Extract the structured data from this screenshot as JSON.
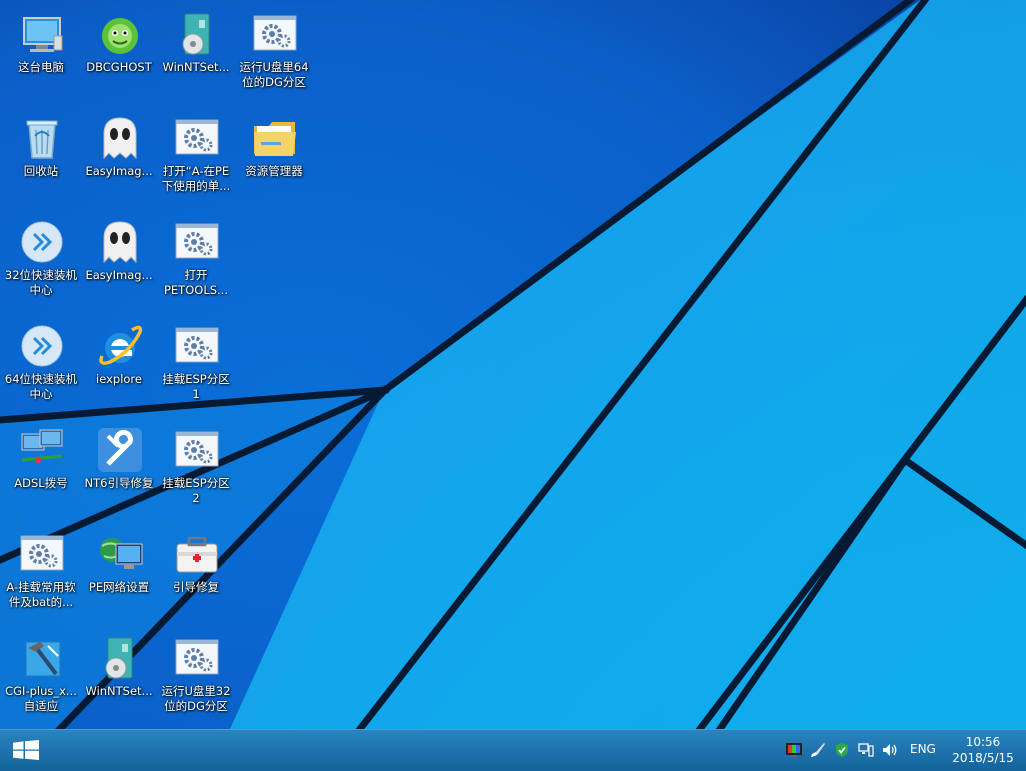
{
  "desktop": {
    "icons": [
      {
        "label": "这台电脑",
        "icon": "computer-icon"
      },
      {
        "label": "DBCGHOST",
        "icon": "ghost-cabbage-icon"
      },
      {
        "label": "WinNTSet...",
        "icon": "setup-disc-icon"
      },
      {
        "label": "运行U盘里64\n位的DG分区",
        "icon": "settings-script-icon"
      },
      {
        "label": "回收站",
        "icon": "recycle-bin-icon"
      },
      {
        "label": "EasyImag...",
        "icon": "ghost-icon"
      },
      {
        "label": "打开“A-在PE\n下使用的单...",
        "icon": "settings-script-icon"
      },
      {
        "label": "资源管理器",
        "icon": "folder-icon"
      },
      {
        "label": "32位快速装机\n中心",
        "icon": "fast-install-icon"
      },
      {
        "label": "EasyImag...",
        "icon": "ghost-icon"
      },
      {
        "label": "打开\nPETOOLS...",
        "icon": "settings-script-icon"
      },
      {
        "label": "64位快速装机\n中心",
        "icon": "fast-install-icon"
      },
      {
        "label": "iexplore",
        "icon": "internet-explorer-icon"
      },
      {
        "label": "挂载ESP分区\n1",
        "icon": "settings-script-icon"
      },
      {
        "label": "ADSL拨号",
        "icon": "network-dial-icon"
      },
      {
        "label": "NT6引导修复",
        "icon": "wrench-icon"
      },
      {
        "label": "挂载ESP分区\n2",
        "icon": "settings-script-icon"
      },
      {
        "label": "A-挂载常用软\n件及bat的...",
        "icon": "settings-script-icon"
      },
      {
        "label": "PE网络设置",
        "icon": "network-globe-icon"
      },
      {
        "label": "引导修复",
        "icon": "first-aid-kit-icon"
      },
      {
        "label": "CGI-plus_x...\n自适应",
        "icon": "hammer-tool-icon"
      },
      {
        "label": "WinNTSet...",
        "icon": "setup-disc-icon"
      },
      {
        "label": "运行U盘里32\n位的DG分区",
        "icon": "settings-script-icon"
      }
    ]
  },
  "taskbar": {
    "start_icon": "windows-logo-icon",
    "tray_icons": [
      "color-display-icon",
      "brush-icon",
      "shield-check-icon",
      "network-icon",
      "volume-icon"
    ],
    "language": "ENG",
    "time": "10:56",
    "date": "2018/5/15"
  }
}
